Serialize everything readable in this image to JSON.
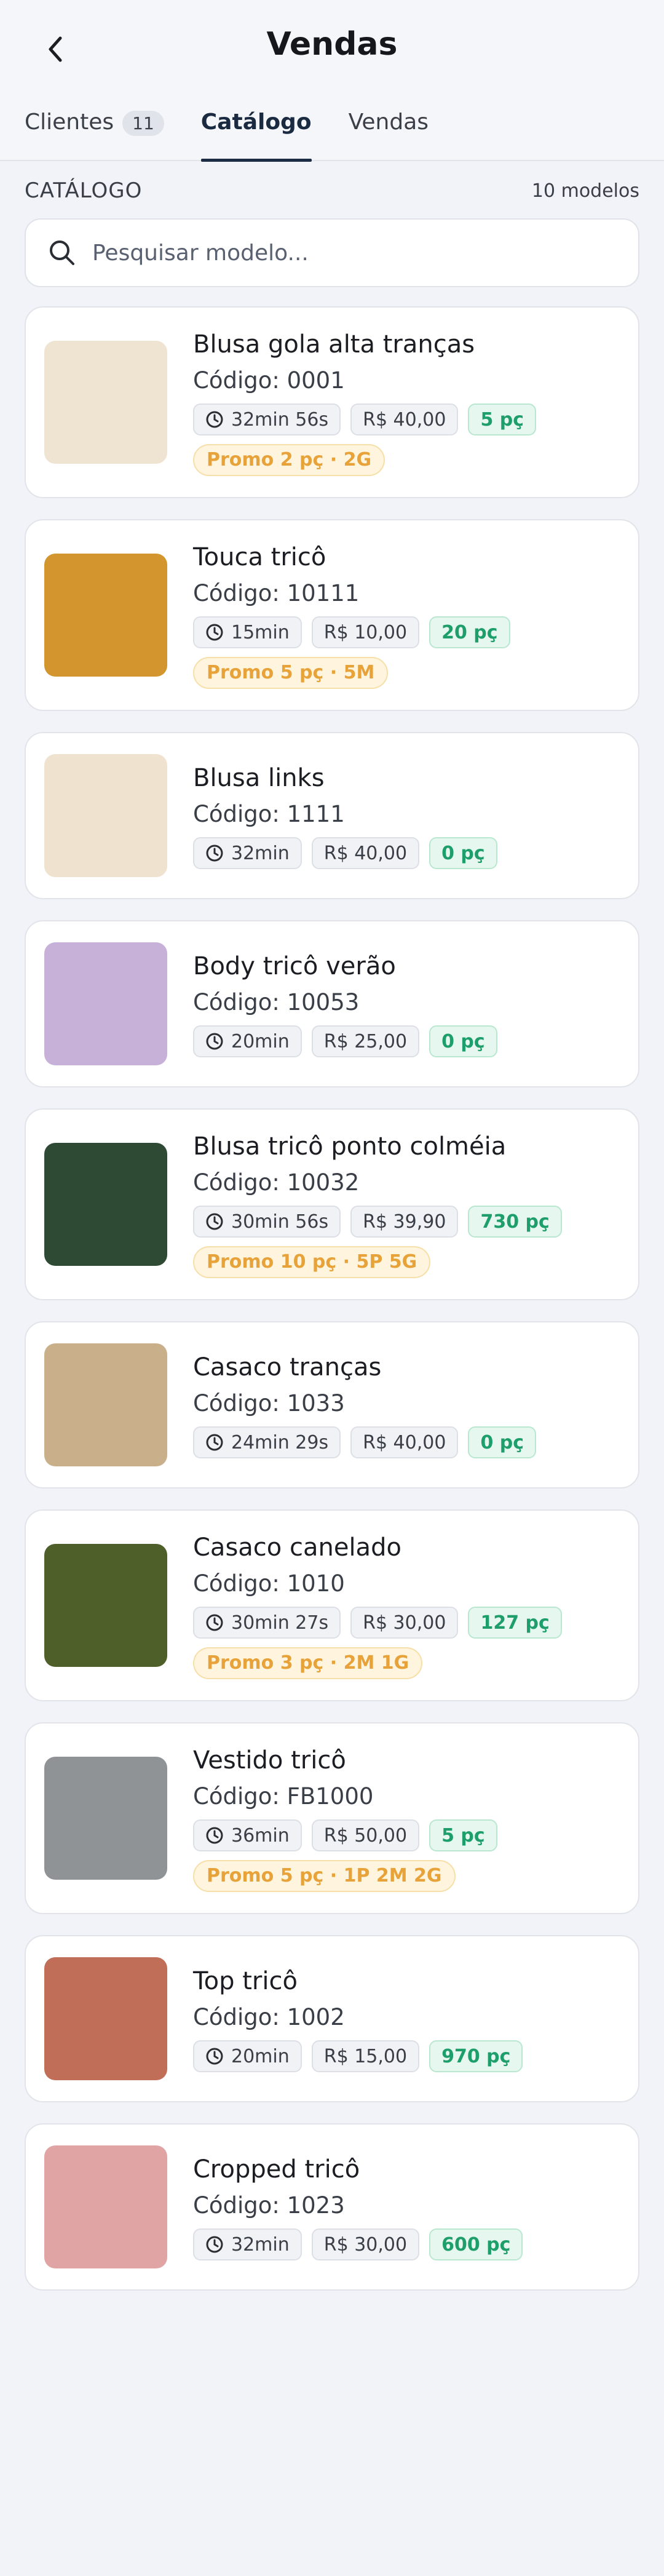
{
  "header": {
    "title": "Vendas",
    "back_icon": "chevron-left-icon"
  },
  "tabs": [
    {
      "label": "Clientes",
      "badge": "11",
      "active": false
    },
    {
      "label": "Catálogo",
      "badge": "",
      "active": true
    },
    {
      "label": "Vendas",
      "badge": "",
      "active": false
    }
  ],
  "section": {
    "title": "CATÁLOGO",
    "count": "10 modelos"
  },
  "search": {
    "placeholder": "Pesquisar modelo...",
    "icon": "search-icon"
  },
  "colors": {
    "accent": "#1d2c45",
    "qty_green": "#1e9e6a",
    "promo_orange": "#e7a33a"
  },
  "products": [
    {
      "name": "Blusa gola alta tranças",
      "code_label": "Código:",
      "code": "0001",
      "time": "32min 56s",
      "price": "R$ 40,00",
      "qty": "5 pç",
      "promo": "Promo 2 pç · 2G",
      "thumb_color": "#efe4d2",
      "thumb_icon": "turtleneck-sweater-image"
    },
    {
      "name": "Touca tricô",
      "code_label": "Código:",
      "code": "10111",
      "time": "15min",
      "price": "R$ 10,00",
      "qty": "20 pç",
      "promo": "Promo 5 pç · 5M",
      "thumb_color": "#d3962e",
      "thumb_icon": "beanie-image"
    },
    {
      "name": "Blusa links",
      "code_label": "Código:",
      "code": "1111",
      "time": "32min",
      "price": "R$ 40,00",
      "qty": "0 pç",
      "promo": "",
      "thumb_color": "#efe2cf",
      "thumb_icon": "sweater-image"
    },
    {
      "name": "Body tricô verão",
      "code_label": "Código:",
      "code": "10053",
      "time": "20min",
      "price": "R$ 25,00",
      "qty": "0 pç",
      "promo": "",
      "thumb_color": "#c8b1d8",
      "thumb_icon": "bodysuit-image"
    },
    {
      "name": "Blusa tricô ponto colméia",
      "code_label": "Código:",
      "code": "10032",
      "time": "30min 56s",
      "price": "R$ 39,90",
      "qty": "730 pç",
      "promo": "Promo 10 pç · 5P 5G",
      "thumb_color": "#2f4a34",
      "thumb_icon": "sweater-image"
    },
    {
      "name": "Casaco tranças",
      "code_label": "Código:",
      "code": "1033",
      "time": "24min 29s",
      "price": "R$ 40,00",
      "qty": "0 pç",
      "promo": "",
      "thumb_color": "#c9b08a",
      "thumb_icon": "cardigan-image"
    },
    {
      "name": "Casaco canelado",
      "code_label": "Código:",
      "code": "1010",
      "time": "30min 27s",
      "price": "R$ 30,00",
      "qty": "127 pç",
      "promo": "Promo 3 pç · 2M 1G",
      "thumb_color": "#4f5f2a",
      "thumb_icon": "cardigan-image"
    },
    {
      "name": "Vestido tricô",
      "code_label": "Código:",
      "code": "FB1000",
      "time": "36min",
      "price": "R$ 50,00",
      "qty": "5 pç",
      "promo": "Promo 5 pç · 1P 2M 2G",
      "thumb_color": "#8f9396",
      "thumb_icon": "dress-image"
    },
    {
      "name": "Top tricô",
      "code_label": "Código:",
      "code": "1002",
      "time": "20min",
      "price": "R$ 15,00",
      "qty": "970 pç",
      "promo": "",
      "thumb_color": "#c06e58",
      "thumb_icon": "top-image"
    },
    {
      "name": "Cropped tricô",
      "code_label": "Código:",
      "code": "1023",
      "time": "32min",
      "price": "R$ 30,00",
      "qty": "600 pç",
      "promo": "",
      "thumb_color": "#dfa4a3",
      "thumb_icon": "sweater-image"
    }
  ]
}
